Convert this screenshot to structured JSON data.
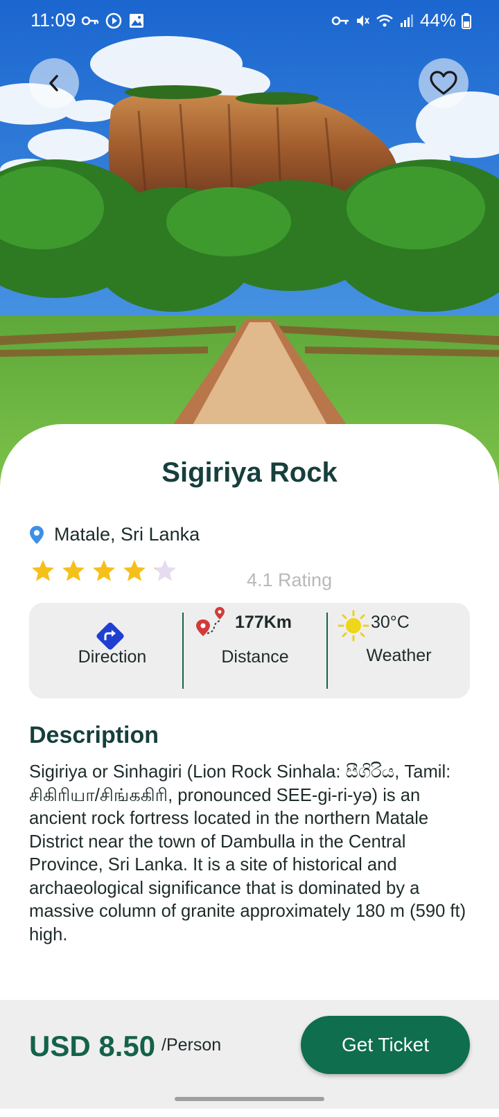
{
  "status_bar": {
    "time": "11:09",
    "battery": "44%",
    "icons": [
      "key-icon",
      "cast-icon",
      "image-icon",
      "vpn-key-icon",
      "mute-icon",
      "wifi-icon",
      "signal-icon",
      "battery-icon"
    ]
  },
  "header": {
    "back_icon": "chevron-left-icon",
    "favorite_icon": "heart-outline-icon"
  },
  "place": {
    "title": "Sigiriya Rock",
    "location": "Matale, Sri Lanka",
    "rating_value": 4.1,
    "rating_max": 5,
    "rating_text": "4.1 Rating"
  },
  "info": {
    "direction_label": "Direction",
    "distance_value": "177Km",
    "distance_label": "Distance",
    "weather_value": "30°C",
    "weather_label": "Weather"
  },
  "description": {
    "heading": "Description",
    "text": "Sigiriya or Sinhagiri (Lion Rock Sinhala: සීගිරිය, Tamil: சிகிரியா/சிங்ககிரி, pronounced SEE-gi-ri-yə) is an ancient rock fortress located in the northern Matale District near the town of Dambulla in the Central Province, Sri Lanka. It is a site of historical and archaeological significance that is dominated by a massive column of granite approximately 180 m (590 ft) high."
  },
  "footer": {
    "price": "USD 8.50",
    "per": "/Person",
    "button_label": "Get Ticket"
  },
  "colors": {
    "primary": "#0e6e4d",
    "title": "#163f3d",
    "star": "#f5c01a",
    "card_bg": "#eeeeee"
  }
}
